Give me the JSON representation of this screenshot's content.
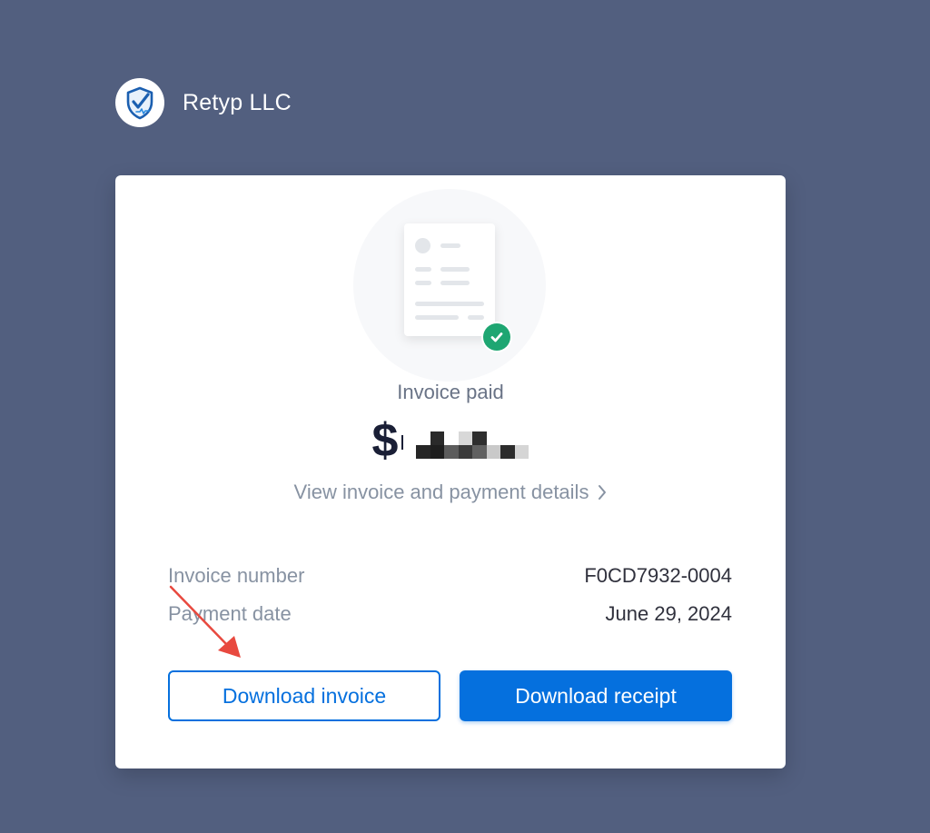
{
  "merchant": {
    "name": "Retyp LLC",
    "logo_icon": "shield-check-icon"
  },
  "invoice": {
    "status": "Invoice paid",
    "amount_currency": "$",
    "view_details_link": "View invoice and payment details",
    "number_label": "Invoice number",
    "number_value": "F0CD7932-0004",
    "date_label": "Payment date",
    "date_value": "June 29, 2024"
  },
  "actions": {
    "download_invoice": "Download invoice",
    "download_receipt": "Download receipt"
  },
  "colors": {
    "background": "#525f7f",
    "accent": "#0570de",
    "success": "#1ea672",
    "annotation_arrow": "#e8493f"
  }
}
